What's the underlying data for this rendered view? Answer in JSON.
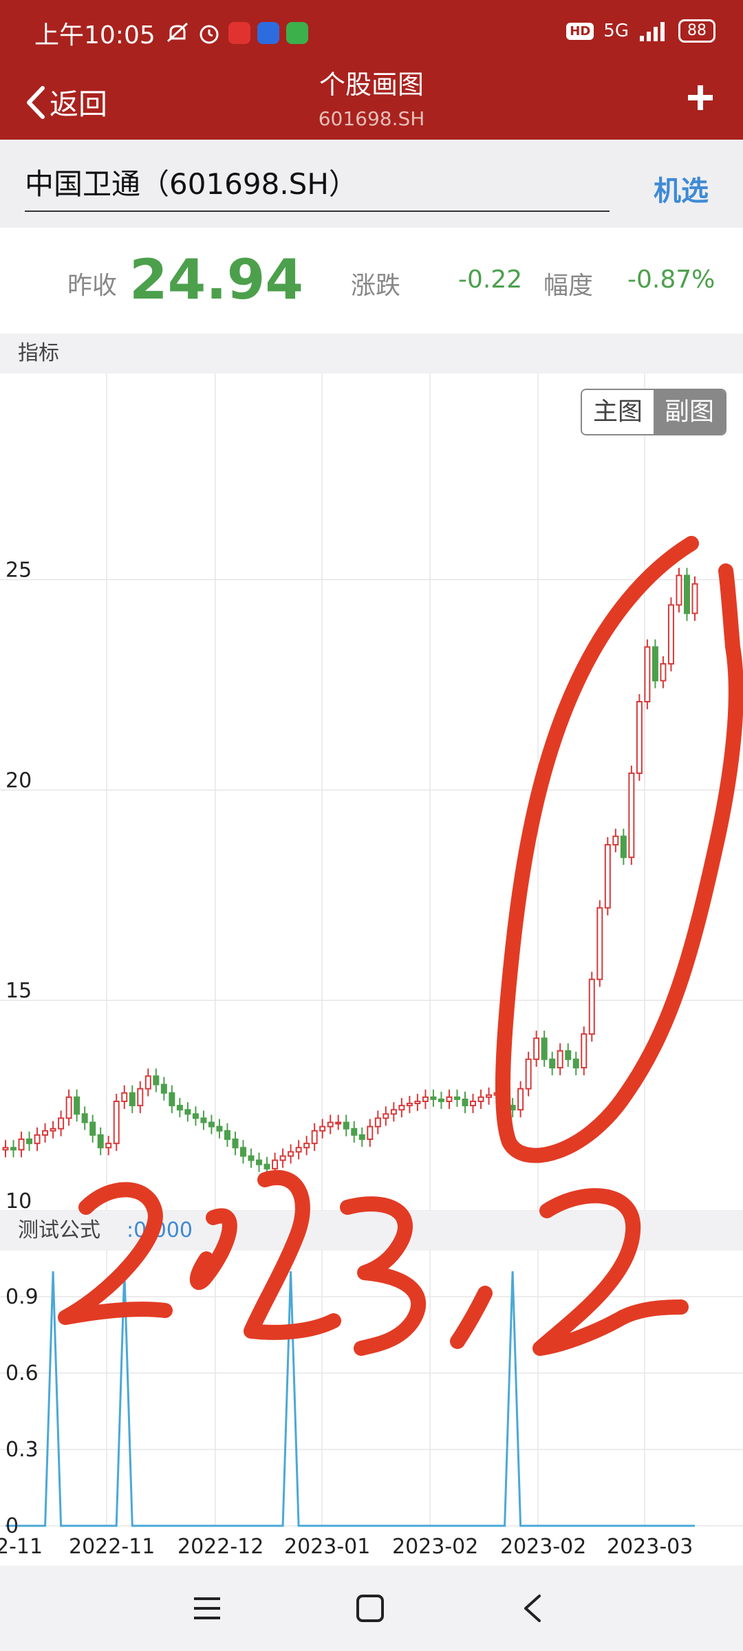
{
  "status": {
    "time": "上午10:05",
    "hd": "HD",
    "network": "5G",
    "battery": "88"
  },
  "header": {
    "back_label": "返回",
    "title": "个股画图",
    "subtitle": "601698.SH"
  },
  "stock": {
    "name": "中国卫通（601698.SH）",
    "pick_label": "机选"
  },
  "quote": {
    "prev_close_label": "昨收",
    "prev_close": "24.94",
    "change_label": "涨跌",
    "change": "-0.22",
    "pct_label": "幅度",
    "pct": "-0.87%"
  },
  "indicator": {
    "label": "指标"
  },
  "toggle": {
    "main": "主图",
    "sub": "副图"
  },
  "formula": {
    "label": "测试公式",
    "value": ":0.000"
  },
  "annotation": "2023.2",
  "colors": {
    "header": "#A9221E",
    "up": "#D8393A",
    "down": "#4CA04C",
    "accent": "#3E8AD6",
    "ink": "#E23B24"
  },
  "chart_data": [
    {
      "type": "candlestick",
      "y_ticks": [
        10,
        15,
        20,
        25
      ],
      "ylim": [
        10,
        29.9
      ],
      "x_ticks": [
        "2-11",
        "2022-11",
        "2022-12",
        "2023-01",
        "2023-02",
        "2023-02",
        "2023-03"
      ],
      "closes": [
        11.5,
        11.45,
        11.7,
        11.6,
        11.8,
        11.9,
        11.95,
        12.2,
        12.7,
        12.3,
        12.1,
        11.8,
        11.5,
        11.6,
        12.6,
        12.8,
        12.5,
        12.9,
        13.2,
        13,
        12.8,
        12.5,
        12.4,
        12.3,
        12.2,
        12.1,
        12,
        11.9,
        11.7,
        11.5,
        11.3,
        11.2,
        11.1,
        11,
        11.2,
        11.3,
        11.4,
        11.5,
        11.6,
        11.9,
        12,
        12.1,
        12.1,
        11.95,
        11.8,
        11.7,
        12,
        12.2,
        12.3,
        12.4,
        12.5,
        12.55,
        12.6,
        12.7,
        12.65,
        12.6,
        12.7,
        12.65,
        12.5,
        12.6,
        12.7,
        12.75,
        12.8,
        12.5,
        12.4,
        12.9,
        13.6,
        14.1,
        13.6,
        13.4,
        13.8,
        13.6,
        13.4,
        14.2,
        15.5,
        17.2,
        18.7,
        18.9,
        18.4,
        20.4,
        22.1,
        23.4,
        22.6,
        23,
        24.4,
        25.1,
        24.2,
        24.9
      ]
    },
    {
      "type": "line",
      "y_ticks": [
        0,
        0.3,
        0.6,
        0.9
      ],
      "ylim": [
        0,
        1
      ],
      "spikes_at": [
        6,
        15,
        36,
        64
      ],
      "spike_value": 1.0,
      "count": 88
    }
  ]
}
